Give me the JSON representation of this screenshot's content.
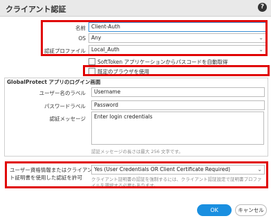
{
  "dialog": {
    "title": "クライアント認証",
    "help_icon": "question-circle-icon"
  },
  "fields": {
    "name_label": "名前",
    "name_value": "Client-Auth",
    "os_label": "OS",
    "os_value": "Any",
    "auth_profile_label": "認証プロファイル",
    "auth_profile_value": "Local_Auth"
  },
  "checkboxes": {
    "softtoken_label": "SoftToken アプリケーションからパスコードを自動取得",
    "default_browser_label": "既定のブラウザを使用"
  },
  "login_screen": {
    "title": "GlobalProtect アプリのログイン画面",
    "username_label": "ユーザー名のラベル",
    "username_value": "Username",
    "password_label": "パスワードラベル",
    "password_value": "Password",
    "auth_message_label": "認証メッセージ",
    "auth_message_value": "Enter login credentials",
    "auth_message_hint": "認証メッセージの長さは最大 256 文字です。"
  },
  "cert_auth": {
    "label_line1": "ユーザー資格情報またはクライアン",
    "label_line2": "ト証明書を使用した認証を許可",
    "value": "Yes (User Credentials OR Client Certificate Required)",
    "hint_line1": "クライアント証明書の認証を強制するには、クライアント認証設定で証明書プロファ",
    "hint_line2": "イルを選択する必要もあります。"
  },
  "buttons": {
    "ok": "OK",
    "cancel": "キャンセル"
  },
  "colors": {
    "highlight": "#e00000",
    "primary": "#1a8fe0"
  }
}
